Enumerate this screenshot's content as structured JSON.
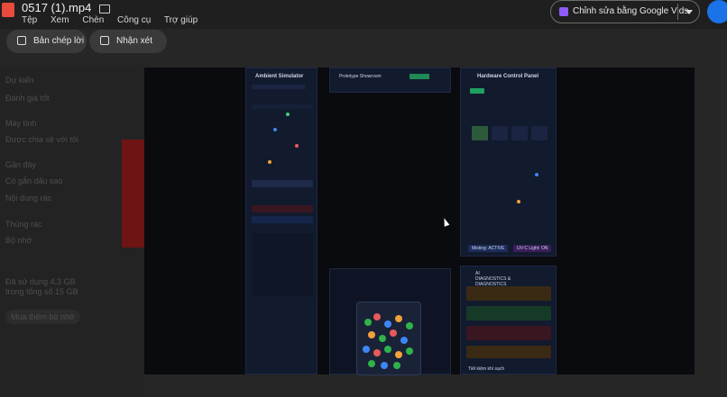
{
  "window": {
    "title": "0517 (1).mp4",
    "menu": [
      "Tệp",
      "Xem",
      "Chèn",
      "Công cụ",
      "Trợ giúp"
    ]
  },
  "header": {
    "edit_vids_label": "Chỉnh sửa bằng Google Vids"
  },
  "toolbar": {
    "transcript_label": "Bản chép lời",
    "comment_label": "Nhận xét"
  },
  "transcript": {
    "lines": [
      "Dự kiến",
      "Đánh giá tốt",
      "Máy tính",
      "Được chia sẻ với tôi",
      "Gần đây",
      "Có gắn dấu sao",
      "Nội dung rác",
      "Thùng rác",
      "Bộ nhớ",
      "Đã sử dụng 4,3 GB trong tổng số 15 GB",
      "Mua thêm bộ nhớ"
    ]
  },
  "video": {
    "left_panel_title": "Ambient Simulator",
    "middle_panel_title": "Prototype Showroom",
    "right_panel_title": "Hardware Control Panel",
    "diagnostics_title": "AI DIAGNOSTICS & DIAGNOSTICS",
    "mode_label": "Misting: ACTIVE",
    "uv_label": "UV-C Light: ON",
    "footer_label": "Tiết kiệm khí sạch"
  }
}
